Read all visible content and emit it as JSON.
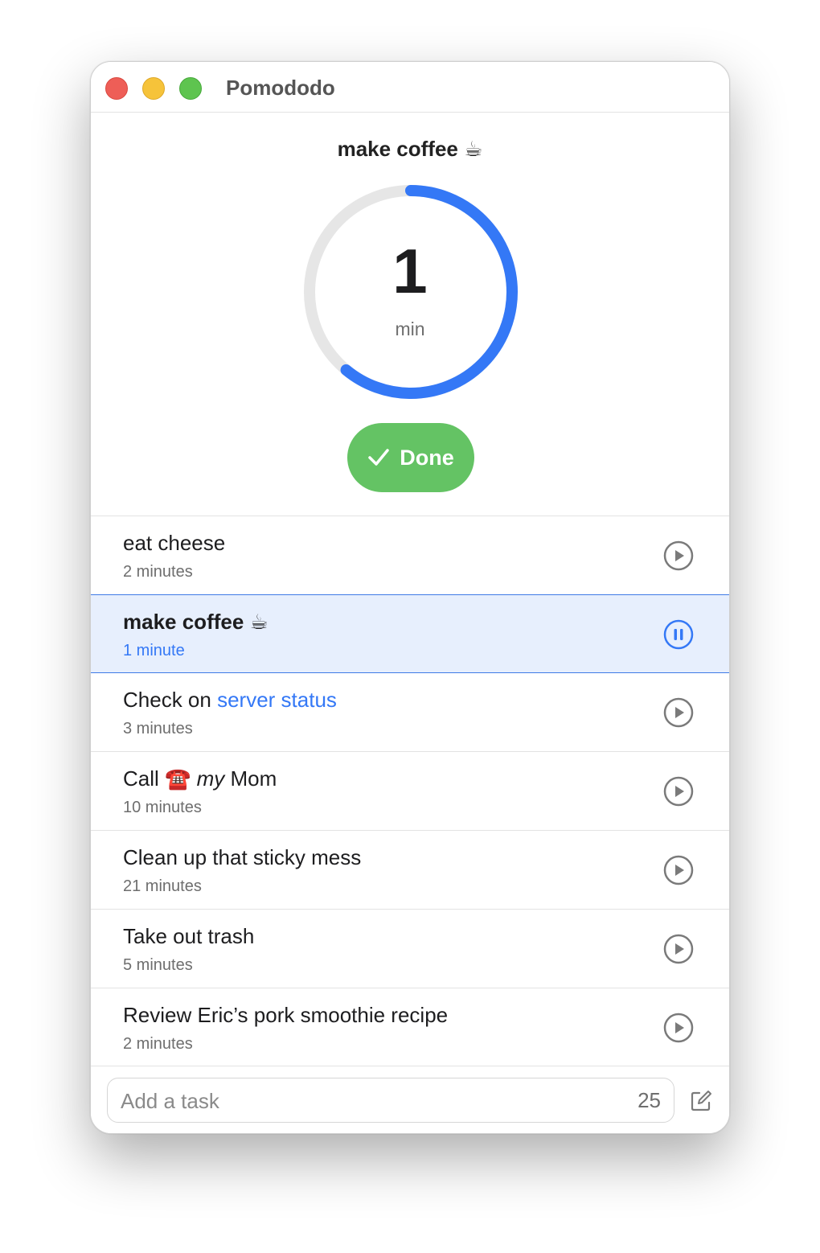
{
  "window": {
    "title": "Pomododo"
  },
  "timer": {
    "current_task": "make coffee ☕",
    "value": "1",
    "unit": "min",
    "progress_fraction": 0.61,
    "progress_color": "#3478f6",
    "track_color": "#e6e6e6"
  },
  "done_button": {
    "label": "Done",
    "color": "#64c364"
  },
  "tasks": [
    {
      "title": "eat cheese",
      "duration": "2 minutes",
      "state": "play"
    },
    {
      "title": "make coffee ☕",
      "duration": "1 minute",
      "state": "pause",
      "active": true
    },
    {
      "title_prefix": "Check on ",
      "title_link": "server status",
      "duration": "3 minutes",
      "state": "play"
    },
    {
      "title_prefix": "Call ☎️ ",
      "title_italic": "my",
      "title_suffix": " Mom",
      "duration": "10 minutes",
      "state": "play"
    },
    {
      "title": "Clean up that sticky mess",
      "duration": "21 minutes",
      "state": "play"
    },
    {
      "title": "Take out trash",
      "duration": "5 minutes",
      "state": "play"
    },
    {
      "title": "Review Eric’s pork smoothie recipe",
      "duration": "2 minutes",
      "state": "play"
    }
  ],
  "add_task": {
    "placeholder": "Add a task",
    "minutes": "25"
  },
  "icons": {
    "play": "play-circle-icon",
    "pause": "pause-circle-icon",
    "done": "checkmark-icon",
    "compose": "compose-icon"
  }
}
